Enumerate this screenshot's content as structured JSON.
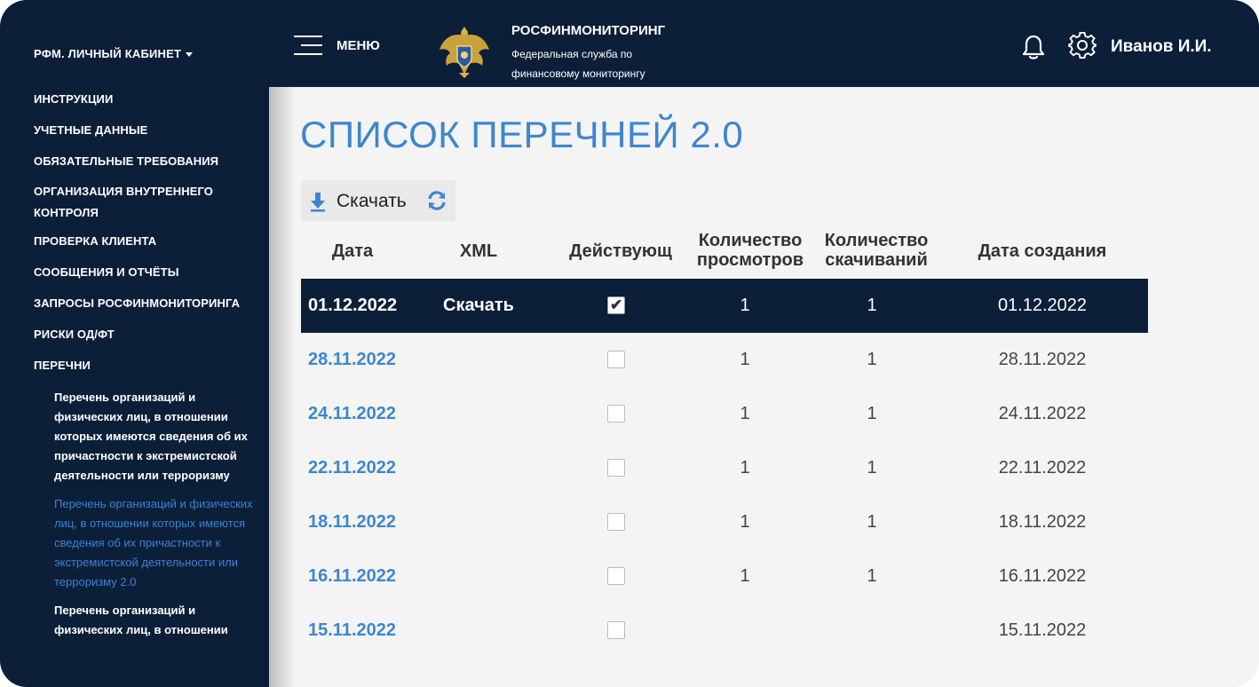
{
  "sidebar": {
    "title": "РФМ. ЛИЧНЫЙ КАБИНЕТ",
    "items": [
      "ИНСТРУКЦИИ",
      "УЧЕТНЫЕ ДАННЫЕ",
      "ОБЯЗАТЕЛЬНЫЕ ТРЕБОВАНИЯ",
      "ОРГАНИЗАЦИЯ ВНУТРЕННЕГО",
      "КОНТРОЛЯ",
      "ПРОВЕРКА КЛИЕНТА",
      "СООБЩЕНИЯ И ОТЧЁТЫ",
      "ЗАПРОСЫ РОСФИНМОНИТОРИНГА",
      "РИСКИ ОД/ФТ",
      "ПЕРЕЧНИ"
    ],
    "subitems": [
      "Перечень организаций и физических лиц, в отношении которых имеются сведения об их причастности к экстремистской деятельности или терроризму",
      "Перечень организаций и физических лиц, в отношении которых имеются сведения об их причастности к экстремистской деятельности или терроризму 2.0",
      "Перечень организаций и физических лиц, в отношении"
    ]
  },
  "header": {
    "menu_label": "МЕНЮ",
    "org_name": "РОСФИНМОНИТОРИНГ",
    "org_sub_line1": "Федеральная служба по",
    "org_sub_line2": "финансовому мониторингу",
    "username": "Иванов И.И.",
    "icons": [
      "menu-icon",
      "emblem-logo",
      "bell-icon",
      "gear-icon"
    ]
  },
  "main": {
    "title": "СПИСОК ПЕРЕЧНЕЙ 2.0",
    "toolbar": {
      "download_label": "Скачать"
    },
    "table": {
      "headers": {
        "date": "Дата",
        "xml": "XML",
        "active": "Действующ",
        "views_line1": "Количество",
        "views_line2": "просмотров",
        "downloads_line1": "Количество",
        "downloads_line2": "скачиваний",
        "created": "Дата создания"
      },
      "rows": [
        {
          "date": "01.12.2022",
          "xml": "Скачать",
          "active": true,
          "views": "1",
          "downloads": "1",
          "created": "01.12.2022"
        },
        {
          "date": "28.11.2022",
          "xml": "",
          "active": false,
          "views": "1",
          "downloads": "1",
          "created": "28.11.2022"
        },
        {
          "date": "24.11.2022",
          "xml": "",
          "active": false,
          "views": "1",
          "downloads": "1",
          "created": "24.11.2022"
        },
        {
          "date": "22.11.2022",
          "xml": "",
          "active": false,
          "views": "1",
          "downloads": "1",
          "created": "22.11.2022"
        },
        {
          "date": "18.11.2022",
          "xml": "",
          "active": false,
          "views": "1",
          "downloads": "1",
          "created": "18.11.2022"
        },
        {
          "date": "16.11.2022",
          "xml": "",
          "active": false,
          "views": "1",
          "downloads": "1",
          "created": "16.11.2022"
        },
        {
          "date": "15.11.2022",
          "xml": "",
          "active": false,
          "views": "",
          "downloads": "",
          "created": "15.11.2022"
        }
      ]
    }
  },
  "colors": {
    "navy": "#0c1f38",
    "accent_blue": "#3d86cf",
    "background": "#f4f4f4"
  }
}
